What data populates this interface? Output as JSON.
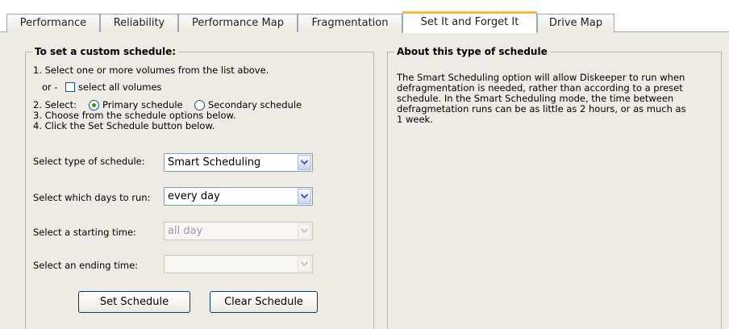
{
  "tabs": [
    {
      "label": "Performance"
    },
    {
      "label": "Reliability"
    },
    {
      "label": "Performance Map"
    },
    {
      "label": "Fragmentation"
    },
    {
      "label": "Set It and Forget It"
    },
    {
      "label": "Drive Map"
    }
  ],
  "custom_schedule": {
    "title": "To set a custom schedule:",
    "step1": "1. Select one or more volumes from the list above.",
    "or_prefix": "or -",
    "select_all_label": "select all volumes",
    "step2_prefix": "2. Select:",
    "radio_primary": "Primary schedule",
    "radio_secondary": "Secondary schedule",
    "step3": "3. Choose from the schedule options below.",
    "step4": "4. Click the Set Schedule button below.",
    "type_label": "Select type of schedule:",
    "type_value": "Smart Scheduling",
    "days_label": "Select which days to run:",
    "days_value": "every day",
    "start_label": "Select a starting time:",
    "start_value": "all day",
    "end_label": "Select an ending time:",
    "end_value": "",
    "set_button": "Set Schedule",
    "clear_button": "Clear Schedule"
  },
  "about": {
    "title": "About this type of schedule",
    "description": "The Smart Scheduling option will allow Diskeeper to run when defragmentation is needed, rather than according to a preset schedule.  In the Smart Scheduling mode, the time between defragmetation runs can be as little as 2 hours, or as much as 1 week."
  },
  "colors": {
    "active_tab_accent": "#f1b84a",
    "panel_background": "#eeebe4",
    "radio_selected": "#2a9b2a"
  }
}
